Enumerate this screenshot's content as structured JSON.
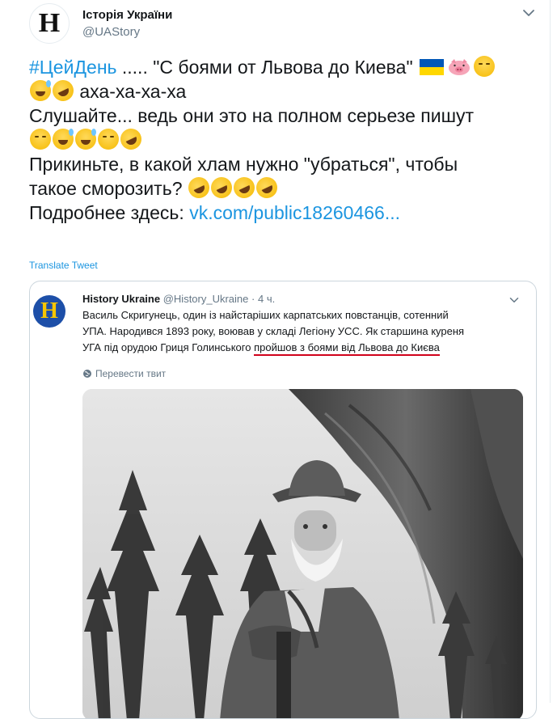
{
  "tweet": {
    "author_name": "Історія України",
    "author_handle": "@UAStory",
    "avatar_letter": "H",
    "lines": {
      "l1_hashtag": "#ЦейДень",
      "l1_text": " ..... \"С боями от Львова до Киева\" ",
      "l2_text": " аха-ха-ха-ха",
      "l3_text": "Слушайте... ведь они это на полном серьезе пишут",
      "l5_text": "Прикиньте, в какой хлам нужно \"убраться\", чтобы",
      "l6_text": "такое сморозить? ",
      "l7_text": "Подробнее здесь: ",
      "l7_link": "vk.com/public18260466..."
    },
    "translate_label": "Translate Tweet",
    "emoji": [
      "ukraine-flag",
      "pig-face",
      "face-with-tears-of-joy",
      "grinning-face-with-sweat",
      "rolling-on-the-floor-laughing"
    ]
  },
  "quoted": {
    "avatar_letter": "H",
    "author_name": "History Ukraine",
    "author_handle": "@History_Ukraine",
    "dot": "·",
    "time": "4 ч.",
    "line1": "Василь Скригунець, один із найстаріших карпатських повстанців, сотенний",
    "line2": "УПА. Народився 1893 року, воював у складі Легіону УСС. Як старшина  куреня",
    "line3_prefix": "УГА під орудою Гриця Голинського ",
    "line3_underlined": "пройшов з боями від Львова до Києва",
    "translate_label": "Перевести твит"
  },
  "colors": {
    "link": "#1b95e0",
    "secondary_text": "#657786",
    "border": "#ccd6dd",
    "underline": "#d0021b",
    "quoted_avatar_bg": "#1d4fa8",
    "quoted_avatar_letter": "#f7c600"
  }
}
